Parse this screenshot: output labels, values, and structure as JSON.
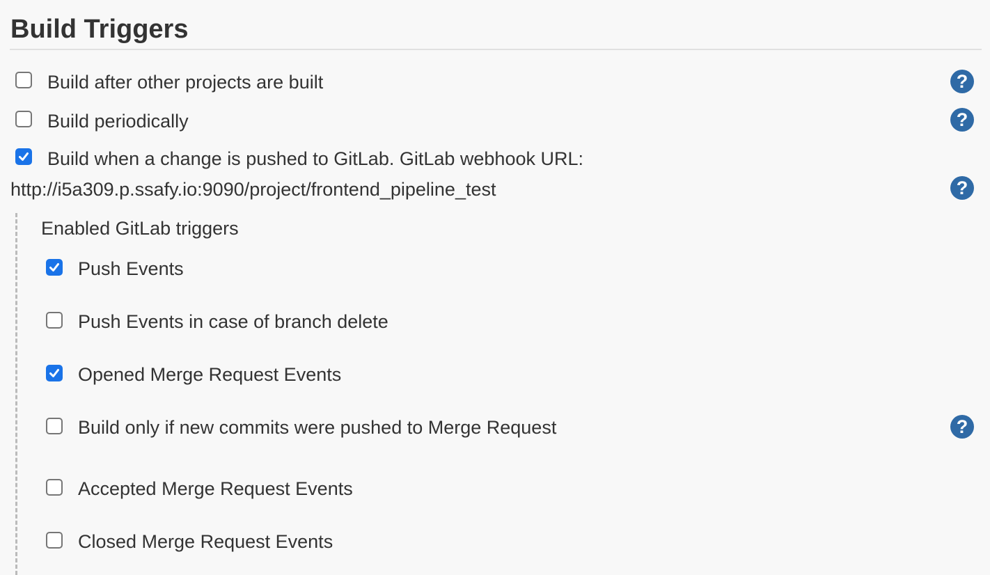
{
  "section": {
    "title": "Build Triggers"
  },
  "triggers": [
    {
      "label": "Build after other projects are built",
      "checked": false,
      "help": "?"
    },
    {
      "label": "Build periodically",
      "checked": false,
      "help": "?"
    },
    {
      "label": "Build when a change is pushed to GitLab. GitLab webhook URL:",
      "checked": true,
      "help": "?"
    }
  ],
  "gitlab": {
    "webhook_url": "http://i5a309.p.ssafy.io:9090/project/frontend_pipeline_test",
    "enabled_triggers_label": "Enabled GitLab triggers",
    "options": [
      {
        "label": "Push Events",
        "checked": true
      },
      {
        "label": "Push Events in case of branch delete",
        "checked": false
      },
      {
        "label": "Opened Merge Request Events",
        "checked": true
      },
      {
        "label": "Build only if new commits were pushed to Merge Request",
        "checked": false,
        "help": "?"
      },
      {
        "label": "Accepted Merge Request Events",
        "checked": false
      },
      {
        "label": "Closed Merge Request Events",
        "checked": false
      }
    ]
  },
  "colors": {
    "checkbox_checked": "#1a73e8",
    "help_icon": "#2f6aa6",
    "text": "#333333",
    "background": "#f8f8f8"
  },
  "icons": {
    "help": "question-circle-icon",
    "check": "checkmark-icon"
  }
}
